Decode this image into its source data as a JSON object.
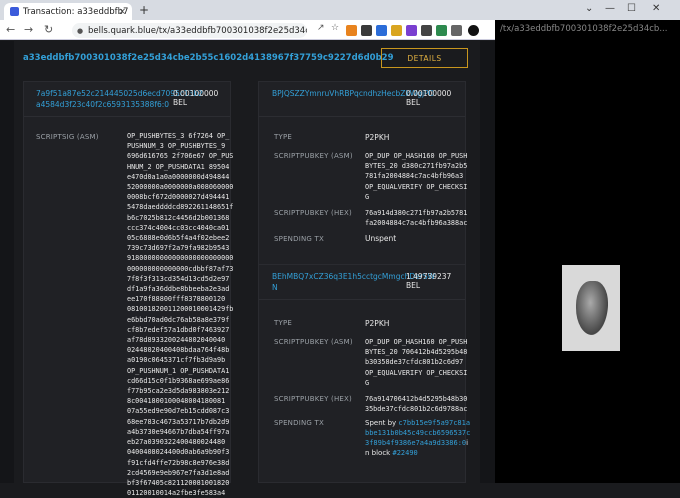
{
  "browser": {
    "tab_title": "Transaction: a33eddbfb7",
    "tab_close": "×",
    "new_tab": "+",
    "url": "bells.quark.blue/tx/a33eddbfb700301038f2e25d34cb...",
    "right_url": "/tx/a33eddbfb700301038f2e25d34cb...",
    "window_controls": [
      "⌄",
      "—",
      "☐",
      "✕"
    ]
  },
  "tx": {
    "id": "a33eddbfb700301038f2e25d34cbe2b55c1602d4138967f37759c9227d6d0b29",
    "details_label": "DETAILS"
  },
  "input": {
    "address_line1": "7a9f51a87e52c214445025d6ecd7095c13b2",
    "address_line2": "a4584d3f23c40f2c6593135388f6:0",
    "amount": "0.00100000 BEL",
    "scriptsig_label": "SCRIPTSIG (ASM)",
    "scriptsig_lines": [
      "OP_PUSHBYTES_3 6f7264 OP_",
      "PUSHNUM_3 OP_PUSHBYTES_9",
      "696d616765 2f706e67 OP_PUS",
      "HNUM_2 OP_PUSHDATA1 89504",
      "e470d0a1a0a0000000d494844",
      "52000000a0000000a008060000",
      "0008bcf672d0000027d494441",
      "5478daeddddcd892261148651f",
      "b6c7025b812c4456d2b001368",
      "ccc374c4004cc03cc4040ca01",
      "05c6888e0d6b5f4a4f02ebee2",
      "739c73d697f2a79fa982b9543",
      "91800000000000000000000000",
      "000000000000000cdbbf87af73",
      "7f8f3f313cd354d13cd5d2e97",
      "df1a9fa36ddbe8bbeeba2e3ad",
      "ee170f88800fff8378800120",
      "081001820011200010001429fb",
      "e6bbd70ad0dc76ab58a8e379f",
      "cf8b7edef57a1dbd0f7463927",
      "af78d8933200244802040040",
      "02448020400408bdaa764f48b",
      "a0190c0645371cf7fb3d9a9b",
      "OP_PUSHNUM_1 OP_PUSHDATA1",
      "cd66d15c0f1b9368ae699ae86",
      "f77b95ca2e3d5da983803e212",
      "8c0041800100048004180081",
      "07a55ed9e90d7eb15cdd087c3",
      "68ee783c4673a53717b7db2d9",
      "a4b3730e94667b7dba54ff97a",
      "eb27a0390322400480024480",
      "0400408024400d0ab6a9b90f3",
      "f91cfd4ffe72b98c8e976e38d",
      "2cd4569e9eb967e7fa3d1e8ad",
      "bf3f67405c821120081001820",
      "01120010014a2fbe3fe583a4"
    ]
  },
  "outputs": [
    {
      "address": "BPJQSZZYmnruVhRBPqcndhzHecbZkWgjPD",
      "amount": "0.00100000 BEL",
      "type_label": "TYPE",
      "type_value": "P2PKH",
      "pubkey_asm_label": "SCRIPTPUBKEY (ASM)",
      "pubkey_asm_lines": [
        "OP_DUP OP_HASH160 OP_PUSH",
        "BYTES_20 d380c271fb97a2b5",
        "781fa2004884c7ac4bfb96a3",
        "OP_EQUALVERIFY OP_CHECKSI",
        "G"
      ],
      "pubkey_hex_label": "SCRIPTPUBKEY (HEX)",
      "pubkey_hex_lines": [
        "76a914d380c271fb97a2b5781",
        "fa2004884c7ac4bfb96a388ac"
      ],
      "spending_label": "SPENDING TX",
      "spending_value": "Unspent"
    },
    {
      "address_line1": "BEhMBQ7xCZ36q3E1h5cctgcMmgchDerSW",
      "address_line2": "N",
      "amount": "1.49739237 BEL",
      "type_label": "TYPE",
      "type_value": "P2PKH",
      "pubkey_asm_label": "SCRIPTPUBKEY (ASM)",
      "pubkey_asm_lines": [
        "OP_DUP OP_HASH160 OP_PUSH",
        "BYTES_20 706412b4d5295b48",
        "b30358de37cfdc801b2c6d97",
        "OP_EQUALVERIFY OP_CHECKSI",
        "G"
      ],
      "pubkey_hex_label": "SCRIPTPUBKEY (HEX)",
      "pubkey_hex_lines": [
        "76a914706412b4d5295b48b30",
        "35bde37cfdc801b2c6d9788ac"
      ],
      "spending_label": "SPENDING TX",
      "spent_by_prefix": "Spent by",
      "spent_by_tx_lines": [
        "c7bb15e9f5a97c81a",
        "bbe131b0b45c49ccb6596537c",
        "3f89b4f9386e7a4a9d3386:0"
      ],
      "spent_suffix": "i",
      "in_block_prefix": "n block",
      "block_link": "#22490"
    }
  ]
}
